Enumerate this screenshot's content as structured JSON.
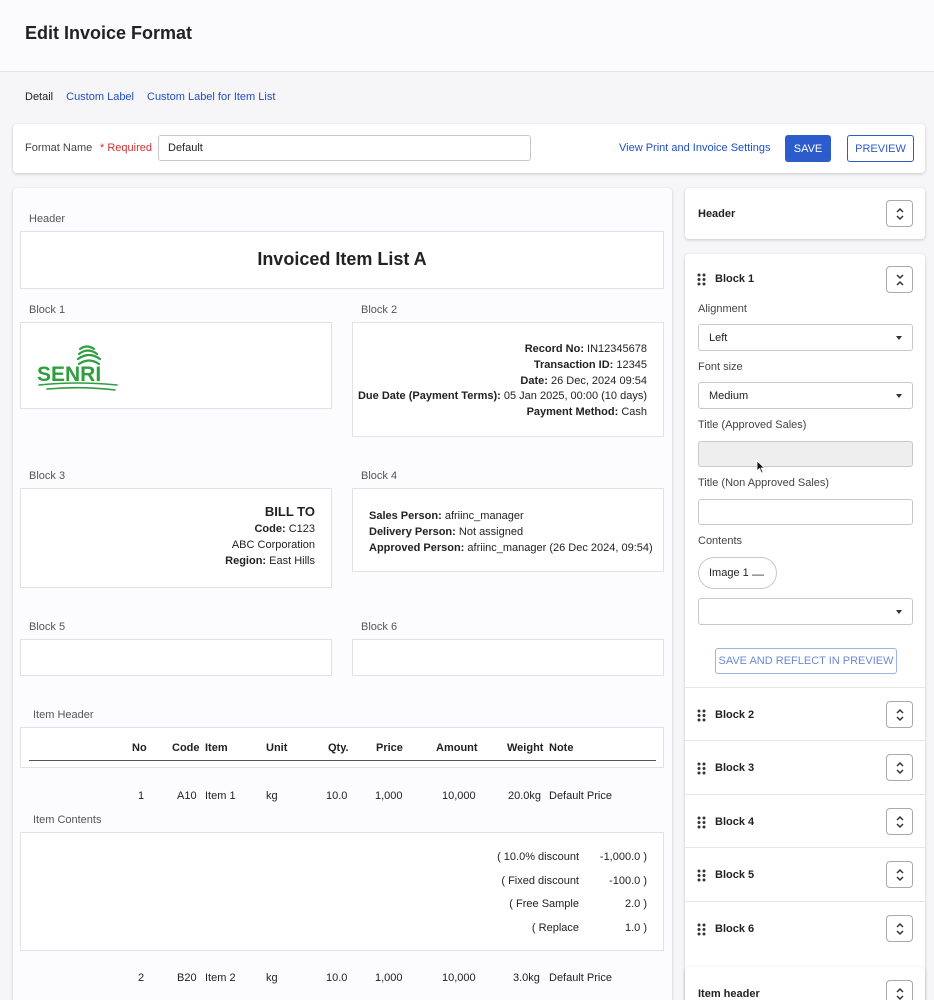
{
  "page": {
    "title": "Edit Invoice Format"
  },
  "tabs": [
    "Detail",
    "Custom Label",
    "Custom Label for Item List"
  ],
  "format": {
    "label": "Format Name",
    "required": "* Required",
    "value": "Default",
    "settings_link": "View Print and Invoice Settings",
    "save_label": "SAVE",
    "preview_label": "PREVIEW"
  },
  "preview": {
    "header": {
      "label": "Header",
      "title": "Invoiced Item List A"
    },
    "block1": {
      "label": "Block 1",
      "logo_text": "SENRI"
    },
    "block2": {
      "label": "Block 2",
      "lines": [
        {
          "k": "Record No:",
          "v": "IN12345678"
        },
        {
          "k": "Transaction ID:",
          "v": "12345"
        },
        {
          "k": "Date:",
          "v": "26 Dec, 2024 09:54"
        },
        {
          "k": "Due Date (Payment Terms):",
          "v": "05 Jan 2025, 00:00 (10 days)"
        },
        {
          "k": "Payment Method:",
          "v": "Cash"
        }
      ]
    },
    "block3": {
      "label": "Block 3",
      "title": "BILL TO",
      "code_k": "Code:",
      "code_v": "C123",
      "company": "ABC Corporation",
      "region_k": "Region:",
      "region_v": "East Hills"
    },
    "block4": {
      "label": "Block 4",
      "lines": [
        {
          "k": "Sales Person:",
          "v": "afriinc_manager"
        },
        {
          "k": "Delivery Person:",
          "v": "Not assigned"
        },
        {
          "k": "Approved Person:",
          "v": "afriinc_manager (26 Dec 2024, 09:54)"
        }
      ]
    },
    "block5": {
      "label": "Block 5"
    },
    "block6": {
      "label": "Block 6"
    },
    "item_header": {
      "label": "Item Header",
      "columns": [
        "No",
        "Code",
        "Item",
        "Unit",
        "Qty.",
        "Price",
        "Amount",
        "Weight",
        "Note"
      ]
    },
    "rows": [
      {
        "no": "1",
        "code": "A10",
        "item": "Item 1",
        "unit": "kg",
        "qty": "10.0",
        "price": "1,000",
        "amount": "10,000",
        "weight": "20.0kg",
        "note": "Default Price"
      },
      {
        "no": "2",
        "code": "B20",
        "item": "Item 2",
        "unit": "kg",
        "qty": "10.0",
        "price": "1,000",
        "amount": "10,000",
        "weight": "3.0kg",
        "note": "Default Price"
      }
    ],
    "item_contents": {
      "label": "Item Contents",
      "lines": [
        {
          "k": "( 10.0% discount",
          "v": "-1,000.0 )"
        },
        {
          "k": "( Fixed discount",
          "v": "-100.0 )"
        },
        {
          "k": "( Free Sample",
          "v": "2.0 )"
        },
        {
          "k": "( Replace",
          "v": "1.0 )"
        }
      ]
    }
  },
  "sidebar": {
    "header_title": "Header",
    "block1": {
      "title": "Block 1",
      "alignment_label": "Alignment",
      "alignment_value": "Left",
      "font_size_label": "Font size",
      "font_size_value": "Medium",
      "title_approved_label": "Title (Approved Sales)",
      "title_non_approved_label": "Title (Non Approved Sales)",
      "contents_label": "Contents",
      "chip_label": "Image 1",
      "chip_remove": "—",
      "reflect_button": "SAVE AND REFLECT IN PREVIEW"
    },
    "blocks": [
      "Block 2",
      "Block 3",
      "Block 4",
      "Block 5",
      "Block 6"
    ],
    "item_header_title": "Item header"
  },
  "colors": {
    "accent": "#2c5ccc",
    "link": "#1f4fbf",
    "required": "#d32f2f",
    "logo": "#2e9e3e"
  },
  "icons": [
    "drag-handle-icon",
    "expand-collapse-icon",
    "dropdown-caret-icon",
    "mouse-cursor-icon"
  ]
}
